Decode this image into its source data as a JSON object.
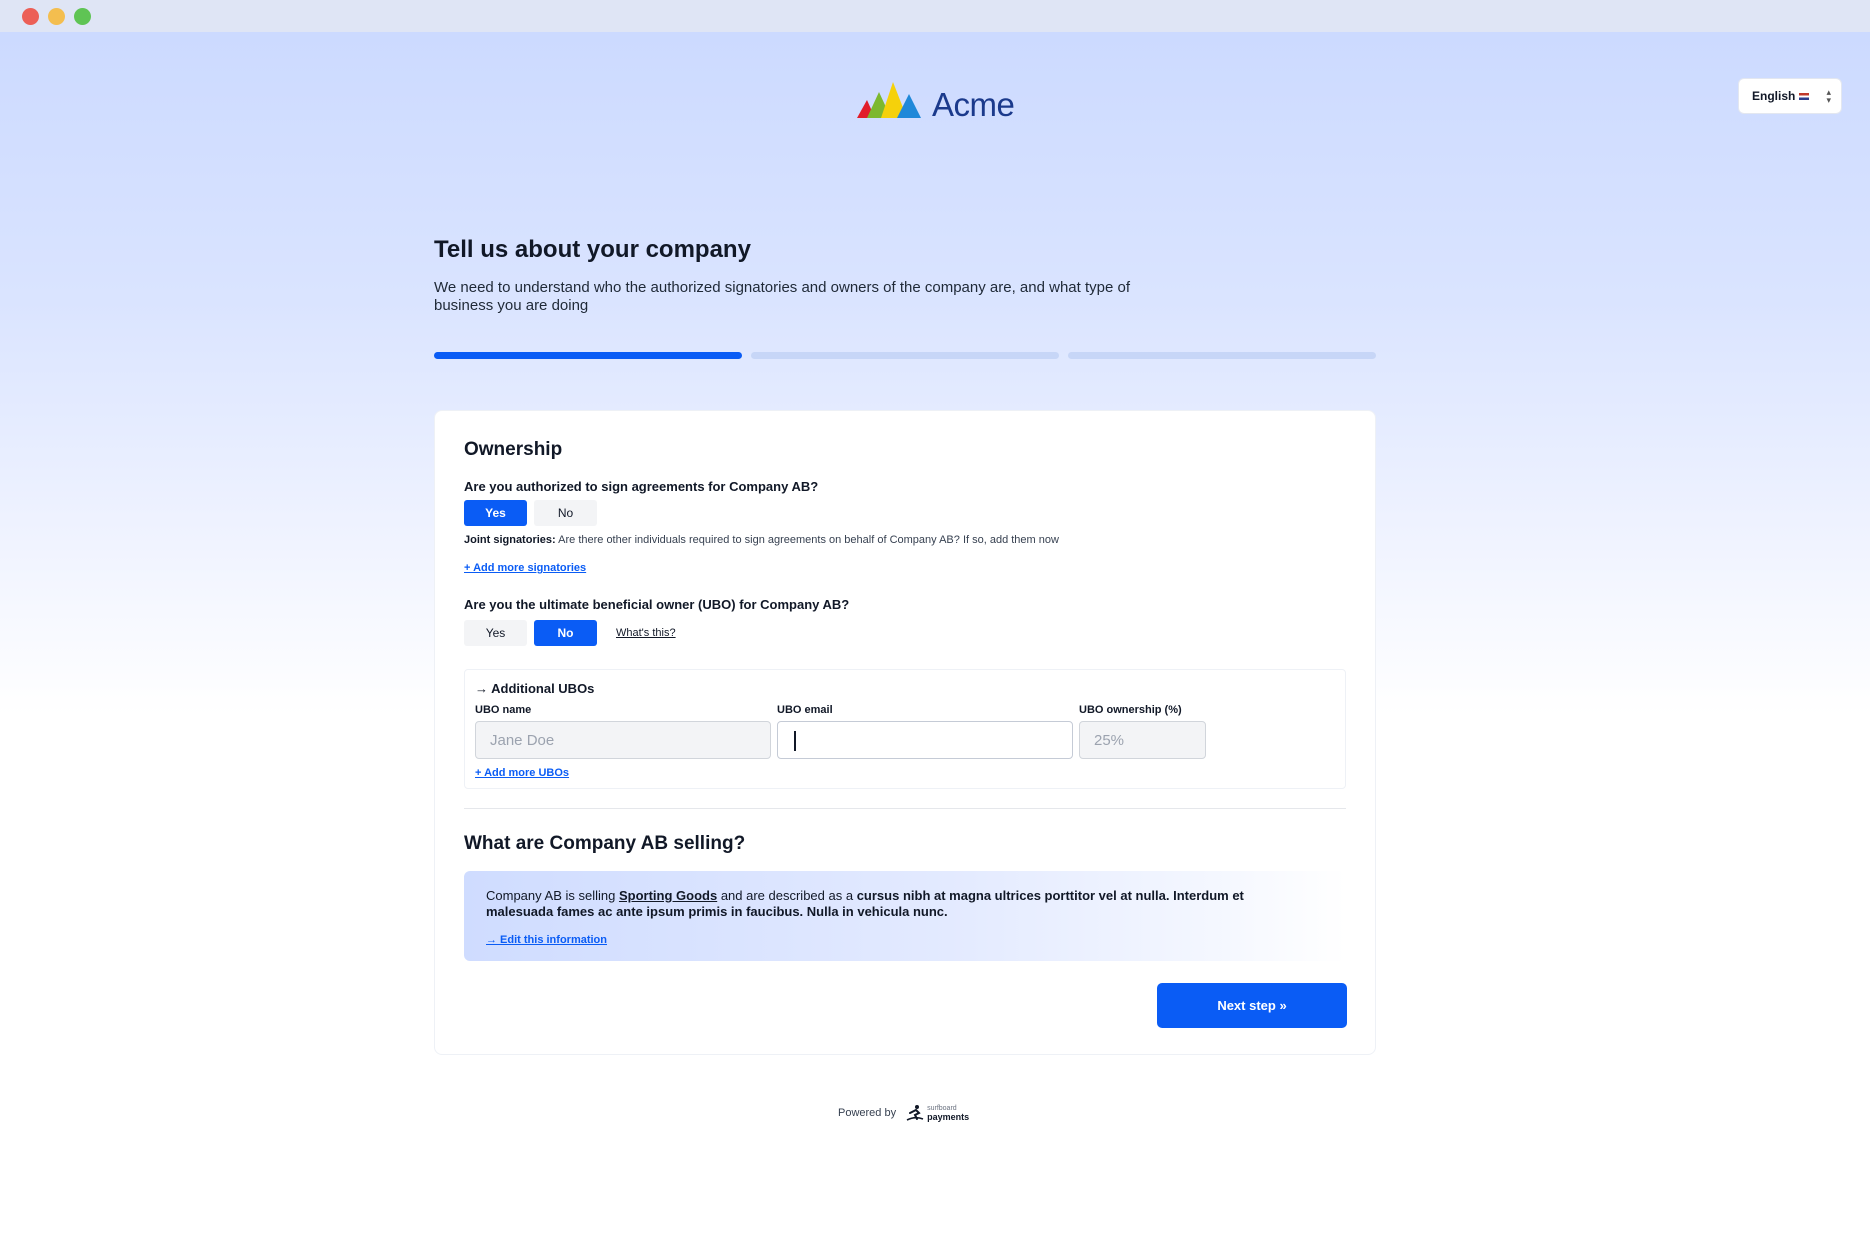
{
  "brand": {
    "name": "Acme"
  },
  "language": {
    "label": "English"
  },
  "page": {
    "title": "Tell us about your company",
    "subtitle": "We need to understand who the authorized signatories and owners of the company are, and what type of business you are doing"
  },
  "progress": {
    "current_step": 1,
    "total_steps": 3
  },
  "ownership": {
    "title": "Ownership",
    "authorized_question": "Are you authorized to sign agreements for Company AB?",
    "authorized_options": [
      "Yes",
      "No"
    ],
    "authorized_selected": "Yes",
    "joint_label": "Joint signatories:",
    "joint_text": "Are there other individuals required to sign agreements on behalf of Company AB? If so, add them now",
    "add_signatories": "+ Add more signatories",
    "ubo_question": "Are you the ultimate beneficial owner (UBO) for Company AB?",
    "ubo_options": [
      "Yes",
      "No"
    ],
    "ubo_selected": "No",
    "whats_this": "What's this?"
  },
  "additional_ubos": {
    "title": "→ Additional UBOs",
    "name_label": "UBO name",
    "name_placeholder": "Jane Doe",
    "email_label": "UBO email",
    "email_value": "",
    "ownership_label": "UBO ownership (%)",
    "ownership_placeholder": "25%",
    "add_more": "+ Add more UBOs"
  },
  "selling": {
    "title": "What are Company AB selling?",
    "text_prefix": "Company AB is selling",
    "category": "Sporting Goods",
    "text_middle": "and are described as a",
    "description": "cursus nibh at magna ultrices porttitor vel at nulla. Interdum et malesuada fames ac ante ipsum primis in faucibus. Nulla in vehicula nunc.",
    "edit_link": "→ Edit this information"
  },
  "actions": {
    "next": "Next step »"
  },
  "footer": {
    "powered_by": "Powered by",
    "partner_top": "surfboard",
    "partner_bottom": "payments"
  },
  "colors": {
    "primary": "#0a5cf5",
    "progress_inactive": "#c7d6f7",
    "brand_text": "#1b3a8c"
  }
}
